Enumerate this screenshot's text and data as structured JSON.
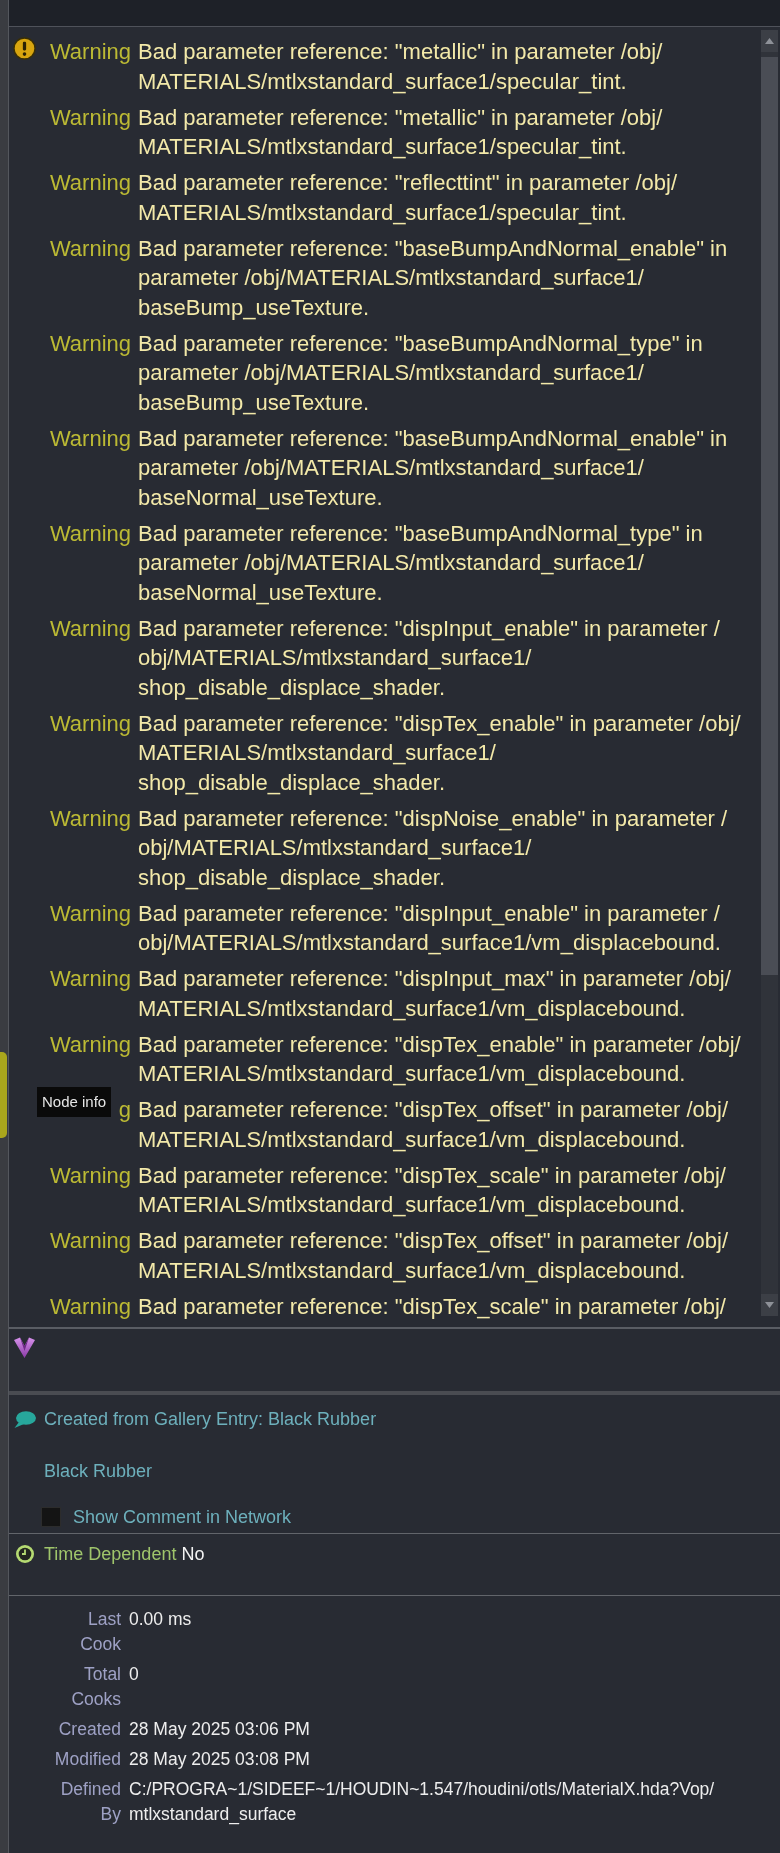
{
  "messages": [
    {
      "kind": "warning",
      "label": "Warning",
      "text": "Bad parameter reference: \"metallic\" in parameter /obj/MATERIALS/mtlxstandard_surface1/specular_tint."
    },
    {
      "kind": "warning",
      "label": "Warning",
      "text": "Bad parameter reference: \"metallic\" in parameter /obj/MATERIALS/mtlxstandard_surface1/specular_tint."
    },
    {
      "kind": "warning",
      "label": "Warning",
      "text": "Bad parameter reference: \"reflecttint\" in parameter /obj/MATERIALS/mtlxstandard_surface1/specular_tint."
    },
    {
      "kind": "warning",
      "label": "Warning",
      "text": "Bad parameter reference: \"baseBumpAndNormal_enable\" in parameter /obj/MATERIALS/mtlxstandard_surface1/baseBump_useTexture."
    },
    {
      "kind": "warning",
      "label": "Warning",
      "text": "Bad parameter reference: \"baseBumpAndNormal_type\" in parameter /obj/MATERIALS/mtlxstandard_surface1/baseBump_useTexture."
    },
    {
      "kind": "warning",
      "label": "Warning",
      "text": "Bad parameter reference: \"baseBumpAndNormal_enable\" in parameter /obj/MATERIALS/mtlxstandard_surface1/baseNormal_useTexture."
    },
    {
      "kind": "warning",
      "label": "Warning",
      "text": "Bad parameter reference: \"baseBumpAndNormal_type\" in parameter /obj/MATERIALS/mtlxstandard_surface1/baseNormal_useTexture."
    },
    {
      "kind": "warning",
      "label": "Warning",
      "text": "Bad parameter reference: \"dispInput_enable\" in parameter /obj/MATERIALS/mtlxstandard_surface1/shop_disable_displace_shader."
    },
    {
      "kind": "warning",
      "label": "Warning",
      "text": "Bad parameter reference: \"dispTex_enable\" in parameter /obj/MATERIALS/mtlxstandard_surface1/shop_disable_displace_shader."
    },
    {
      "kind": "warning",
      "label": "Warning",
      "text": "Bad parameter reference: \"dispNoise_enable\" in parameter /obj/MATERIALS/mtlxstandard_surface1/shop_disable_displace_shader."
    },
    {
      "kind": "warning",
      "label": "Warning",
      "text": "Bad parameter reference: \"dispInput_enable\" in parameter /obj/MATERIALS/mtlxstandard_surface1/vm_displacebound."
    },
    {
      "kind": "warning",
      "label": "Warning",
      "text": "Bad parameter reference: \"dispInput_max\" in parameter /obj/MATERIALS/mtlxstandard_surface1/vm_displacebound."
    },
    {
      "kind": "warning",
      "label": "Warning",
      "text": "Bad parameter reference: \"dispTex_enable\" in parameter /obj/MATERIALS/mtlxstandard_surface1/vm_displacebound."
    },
    {
      "kind": "warning",
      "label": "g",
      "text": "Bad parameter reference: \"dispTex_offset\" in parameter /obj/MATERIALS/mtlxstandard_surface1/vm_displacebound.",
      "tooltip": "Node info"
    },
    {
      "kind": "warning",
      "label": "Warning",
      "text": "Bad parameter reference: \"dispTex_scale\" in parameter /obj/MATERIALS/mtlxstandard_surface1/vm_displacebound."
    },
    {
      "kind": "warning",
      "label": "Warning",
      "text": "Bad parameter reference: \"dispTex_offset\" in parameter /obj/MATERIALS/mtlxstandard_surface1/vm_displacebound."
    },
    {
      "kind": "warning",
      "label": "Warning",
      "text": "Bad parameter reference: \"dispTex_scale\" in parameter /obj/"
    }
  ],
  "comment": {
    "title": "Created from Gallery Entry: Black Rubber",
    "body": "Black Rubber",
    "show_in_network": {
      "label": "Show Comment in Network",
      "checked": false
    }
  },
  "time_dependent": {
    "label": "Time Dependent",
    "value": "No"
  },
  "info": [
    {
      "label": "Last Cook",
      "value": "0.00 ms"
    },
    {
      "label": "Total Cooks",
      "value": "0"
    },
    {
      "label": "Created",
      "value": "28 May 2025 03:06 PM"
    },
    {
      "label": "Modified",
      "value": "28 May 2025 03:08 PM"
    },
    {
      "label": "Defined By",
      "value": "C:/PROGRA~1/SIDEEF~1/HOUDIN~1.547/houdini/otls/MaterialX.hda?Vop/mtlxstandard_surface"
    }
  ]
}
